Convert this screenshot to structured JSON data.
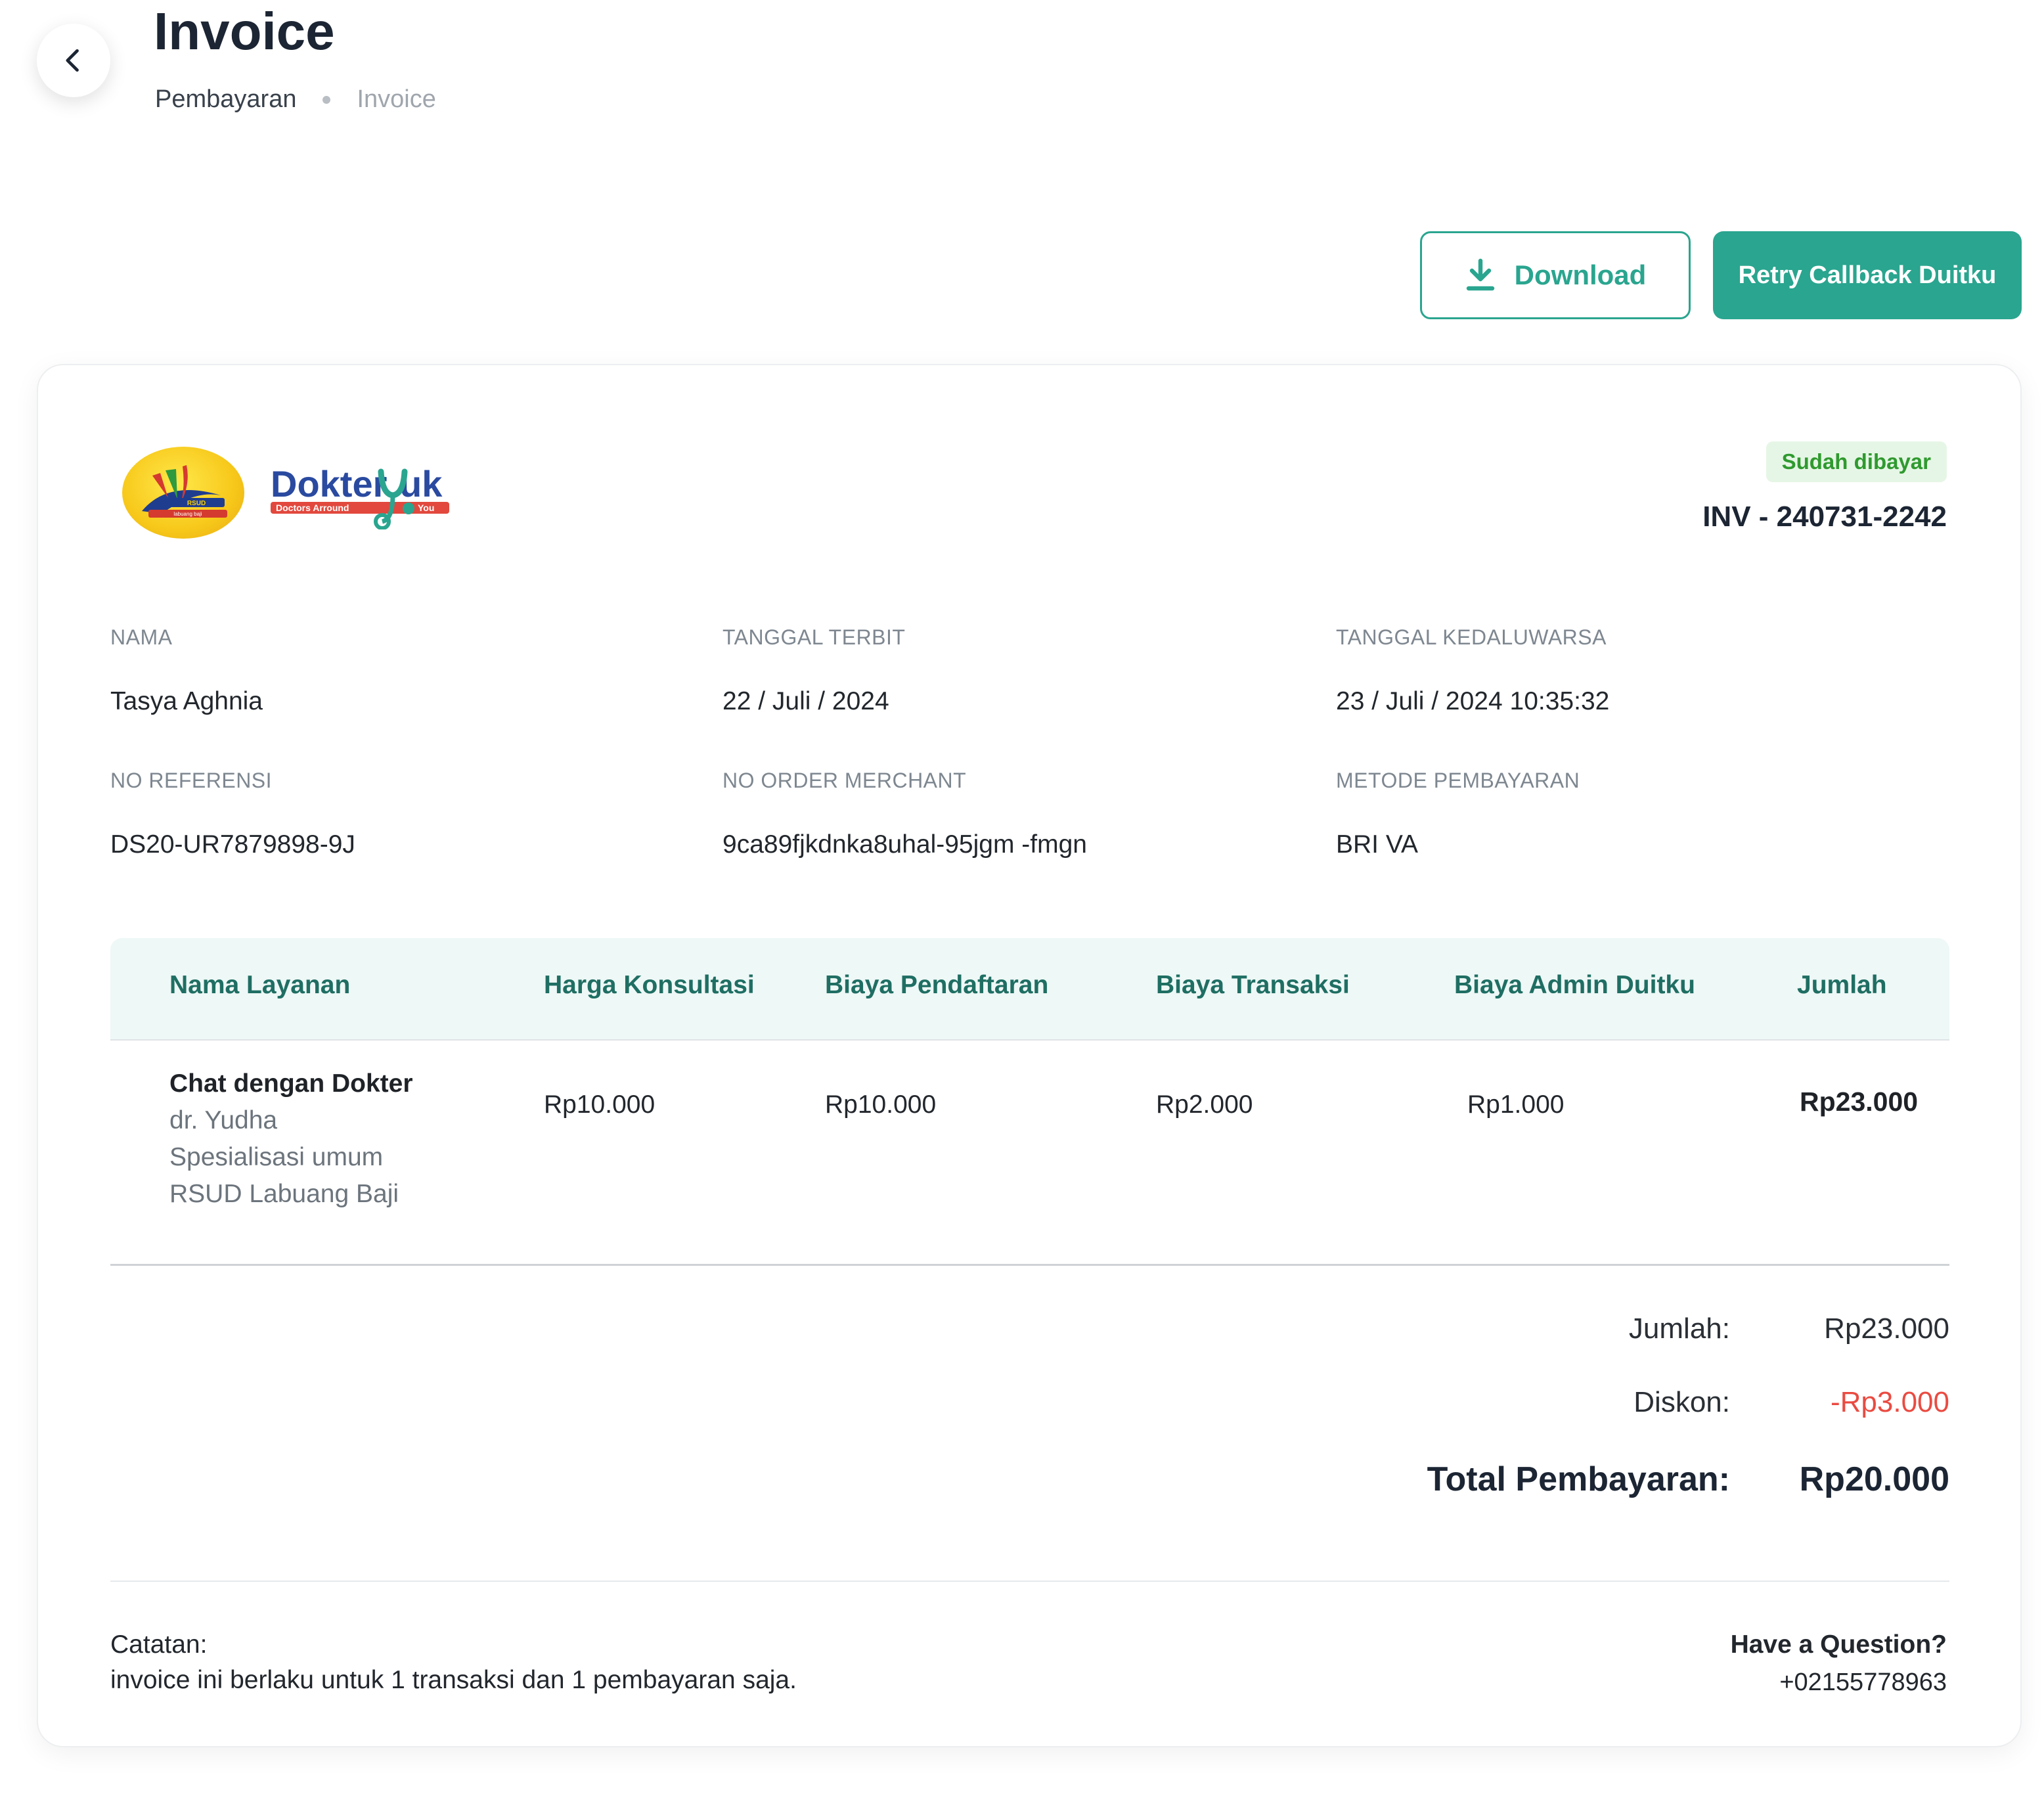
{
  "header": {
    "title": "Invoice",
    "breadcrumb": [
      "Pembayaran",
      "Invoice"
    ]
  },
  "actions": {
    "download_label": "Download",
    "retry_label": "Retry Callback Duitku"
  },
  "invoice": {
    "logos": [
      "RSUD Labuang Baji",
      "Dokter Yuk - Doctors Arround You"
    ],
    "status": "Sudah dibayar",
    "number": "INV - 240731-2242",
    "fields": [
      {
        "label": "NAMA",
        "value": "Tasya Aghnia"
      },
      {
        "label": "TANGGAL TERBIT",
        "value": "22 / Juli / 2024"
      },
      {
        "label": "TANGGAL KEDALUWARSA",
        "value": "23 / Juli / 2024 10:35:32"
      },
      {
        "label": "NO REFERENSI",
        "value": "DS20-UR7879898-9J"
      },
      {
        "label": "NO ORDER MERCHANT",
        "value": "9ca89fjkdnka8uhal-95jgm -fmgn"
      },
      {
        "label": "METODE PEMBAYARAN",
        "value": "BRI VA"
      }
    ],
    "table": {
      "headers": [
        "Nama Layanan",
        "Harga Konsultasi",
        "Biaya Pendaftaran",
        "Biaya Transaksi",
        "Biaya Admin Duitku",
        "Jumlah"
      ],
      "rows": [
        {
          "service": "Chat dengan Dokter",
          "doctor": "dr. Yudha",
          "specialty": "Spesialisasi umum",
          "hospital": "RSUD Labuang Baji",
          "harga_konsultasi": "Rp10.000",
          "biaya_pendaftaran": "Rp10.000",
          "biaya_transaksi": "Rp2.000",
          "biaya_admin": "Rp1.000",
          "jumlah": "Rp23.000"
        }
      ]
    },
    "summary": {
      "subtotal_label": "Jumlah:",
      "subtotal_value": "Rp23.000",
      "discount_label": "Diskon:",
      "discount_value": "-Rp3.000",
      "total_label": "Total Pembayaran:",
      "total_value": "Rp20.000"
    },
    "footer": {
      "note_label": "Catatan:",
      "note_text": "invoice ini berlaku untuk 1 transaksi dan 1 pembayaran saja.",
      "question_label": "Have a Question?",
      "phone": "+02155778963"
    }
  },
  "colors": {
    "accent": "#2aa58f",
    "status_bg": "#e6f6e6",
    "status_text": "#2f9a2f",
    "discount": "#ea4b41",
    "table_head_bg": "#eef8f6",
    "table_head_text": "#1f6e63"
  }
}
